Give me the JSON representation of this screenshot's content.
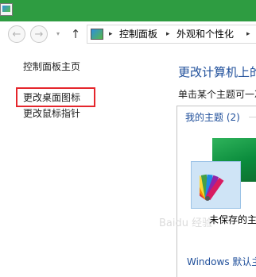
{
  "window": {
    "app_icon": "control-panel-icon"
  },
  "navigation": {
    "back_glyph": "←",
    "forward_glyph": "→",
    "recent_glyph": "▾",
    "up_glyph": "↑",
    "breadcrumb_separator": "▸",
    "breadcrumb": [
      "控制面板",
      "外观和个性化"
    ]
  },
  "sidebar": {
    "items": [
      {
        "label": "控制面板主页"
      },
      {
        "label": "更改桌面图标"
      },
      {
        "label": "更改鼠标指针"
      }
    ]
  },
  "main": {
    "title": "更改计算机上的",
    "description": "单击某个主题可一次",
    "my_themes_label": "我的主题 (2)",
    "unsaved_theme_label": "未保存的主",
    "windows_default_label": "Windows 默认主"
  },
  "watermark_text": "Baidu 经验",
  "colors": {
    "titlebar": "#2e9c41",
    "link": "#1e4e9a",
    "highlight": "#e5262c",
    "tile_bg": "#cfe4f6"
  }
}
